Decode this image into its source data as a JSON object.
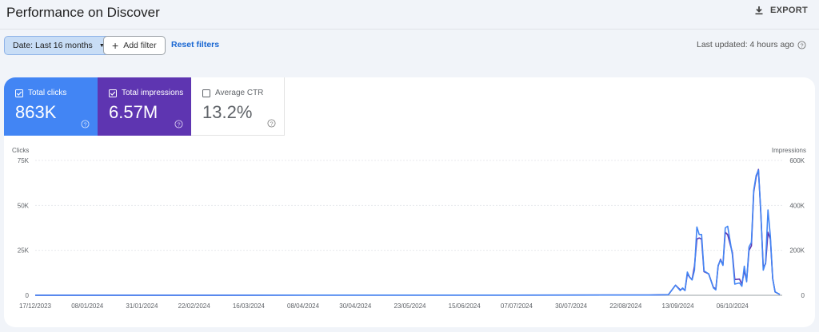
{
  "header": {
    "title": "Performance on Discover",
    "export_label": "EXPORT",
    "export_icon": "download-icon"
  },
  "filters": {
    "date_chip": "Date: Last 16 months",
    "add_filter": "Add filter",
    "reset": "Reset filters",
    "last_updated": "Last updated: 4 hours ago"
  },
  "metrics": [
    {
      "label": "Total clicks",
      "value": "863K",
      "checked": true,
      "color": "#4285f4"
    },
    {
      "label": "Total impressions",
      "value": "6.57M",
      "checked": true,
      "color": "#5e35b1"
    },
    {
      "label": "Average CTR",
      "value": "13.2%",
      "checked": false
    }
  ],
  "chart_data": {
    "type": "line",
    "ylabel_left": "Clicks",
    "ylabel_right": "Impressions",
    "ylim_left": [
      0,
      75000
    ],
    "ylim_right": [
      0,
      600000
    ],
    "yticks_left": [
      "0",
      "25K",
      "50K",
      "75K"
    ],
    "yticks_right": [
      "0",
      "200K",
      "400K",
      "600K"
    ],
    "xlim": [
      "2023-12-17",
      "2024-10-27"
    ],
    "xticks": [
      "17/12/2023",
      "08/01/2024",
      "31/01/2024",
      "22/02/2024",
      "16/03/2024",
      "08/04/2024",
      "30/04/2024",
      "23/05/2024",
      "15/06/2024",
      "07/07/2024",
      "30/07/2024",
      "22/08/2024",
      "13/09/2024",
      "06/10/2024"
    ],
    "grid": true,
    "x": [
      "2023-12-17",
      "2024-03-01",
      "2024-06-01",
      "2024-09-01",
      "2024-09-09",
      "2024-09-12",
      "2024-09-14",
      "2024-09-15",
      "2024-09-16",
      "2024-09-17",
      "2024-09-18",
      "2024-09-19",
      "2024-09-20",
      "2024-09-21",
      "2024-09-22",
      "2024-09-23",
      "2024-09-24",
      "2024-09-26",
      "2024-09-28",
      "2024-09-29",
      "2024-09-30",
      "2024-10-01",
      "2024-10-02",
      "2024-10-03",
      "2024-10-04",
      "2024-10-06",
      "2024-10-07",
      "2024-10-09",
      "2024-10-10",
      "2024-10-11",
      "2024-10-12",
      "2024-10-13",
      "2024-10-14",
      "2024-10-15",
      "2024-10-16",
      "2024-10-17",
      "2024-10-18",
      "2024-10-19",
      "2024-10-20",
      "2024-10-21",
      "2024-10-22",
      "2024-10-23",
      "2024-10-24",
      "2024-10-26"
    ],
    "series": [
      {
        "name": "Clicks",
        "axis": "left",
        "color": "#4285f4",
        "values": [
          50,
          60,
          80,
          150,
          300,
          5600,
          2600,
          4100,
          2600,
          12900,
          10000,
          8500,
          14000,
          38000,
          33800,
          33800,
          13600,
          11900,
          4100,
          3000,
          16600,
          19600,
          16600,
          37500,
          38400,
          22500,
          6200,
          6900,
          5000,
          16200,
          7500,
          26900,
          29400,
          58500,
          66600,
          69600,
          46000,
          14000,
          18000,
          47500,
          32800,
          9200,
          1900,
          500
        ]
      },
      {
        "name": "Impressions",
        "axis": "right",
        "color": "#5e35b1",
        "values": [
          400,
          500,
          600,
          1200,
          3000,
          45000,
          24000,
          30000,
          22000,
          95000,
          80000,
          70000,
          130000,
          250000,
          255000,
          250000,
          105000,
          95000,
          35000,
          28000,
          130000,
          160000,
          135000,
          280000,
          270000,
          190000,
          70000,
          72000,
          50000,
          110000,
          65000,
          200000,
          220000,
          460000,
          525000,
          560000,
          360000,
          125000,
          140000,
          280000,
          250000,
          75000,
          15000,
          4000
        ]
      }
    ]
  }
}
